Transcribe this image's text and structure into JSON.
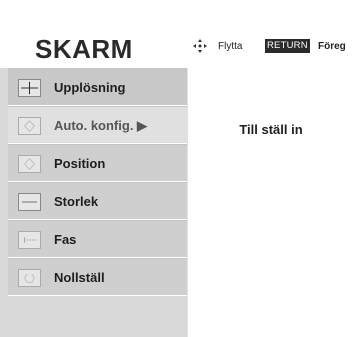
{
  "header": {
    "title": "SKARM",
    "hint_move_label": "Flytta",
    "hint_return_key": "RETURN",
    "hint_return_label": "Föreg"
  },
  "menu": {
    "items": [
      {
        "label": "Upplösning",
        "icon": "grid-icon"
      },
      {
        "label": "Auto. konfig. ▶",
        "icon": "auto-config-icon"
      },
      {
        "label": "Position",
        "icon": "position-icon"
      },
      {
        "label": "Storlek",
        "icon": "size-icon"
      },
      {
        "label": "Fas",
        "icon": "phase-icon"
      },
      {
        "label": "Nollställ",
        "icon": "reset-icon"
      }
    ]
  },
  "content": {
    "text": "Till ställ in"
  }
}
